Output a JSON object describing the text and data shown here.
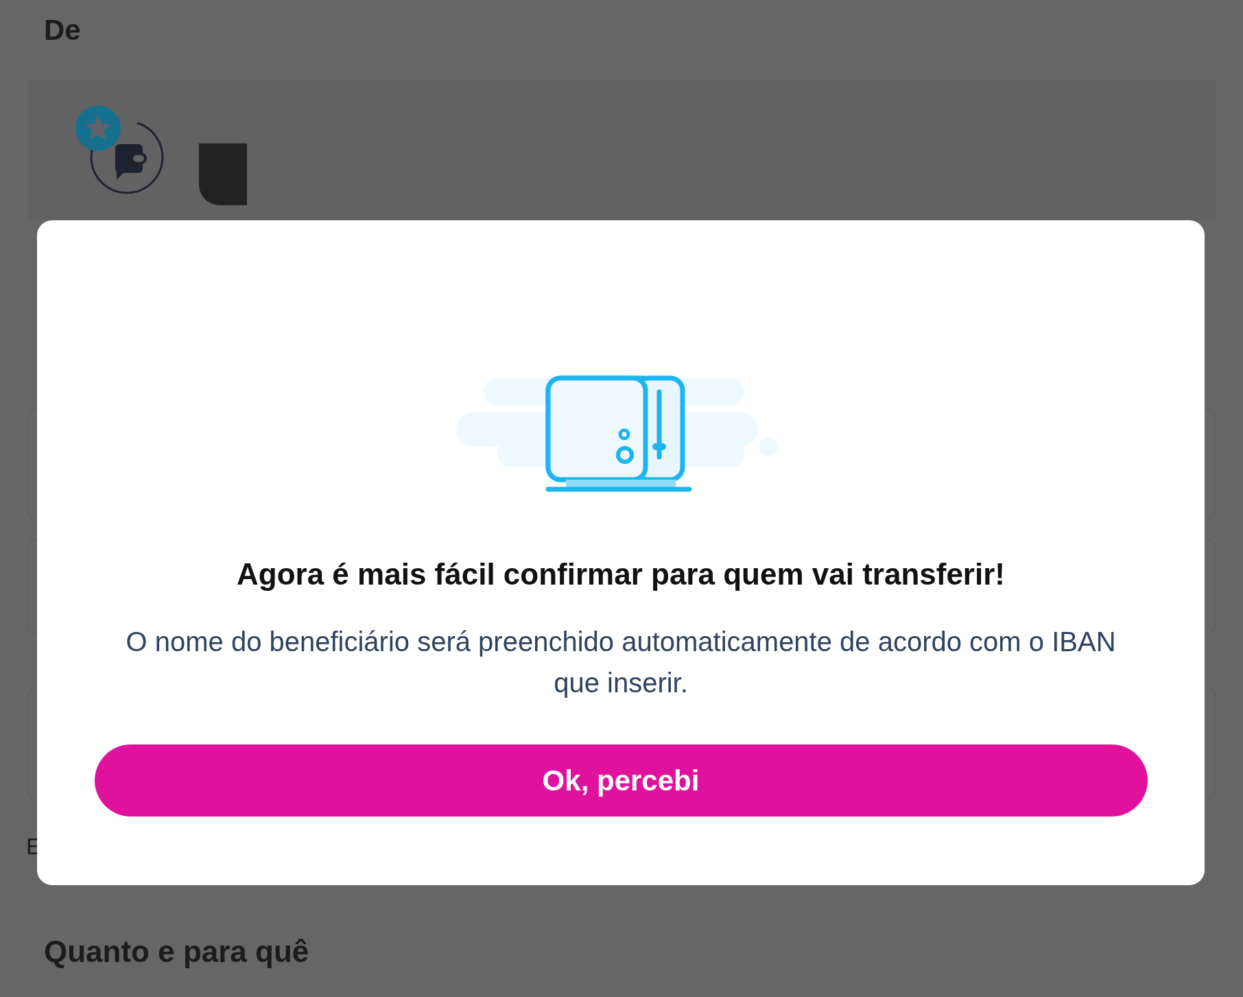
{
  "page": {
    "section_title": "De",
    "cut_label": "E",
    "next_section_title": "Quanto e para quê"
  },
  "dialog": {
    "title": "Agora é mais fácil confirmar para quem vai transferir!",
    "message": "O nome do beneficiário será preenchido automaticamente de acordo com o IBAN que inserir.",
    "button": "Ok, percebi"
  }
}
